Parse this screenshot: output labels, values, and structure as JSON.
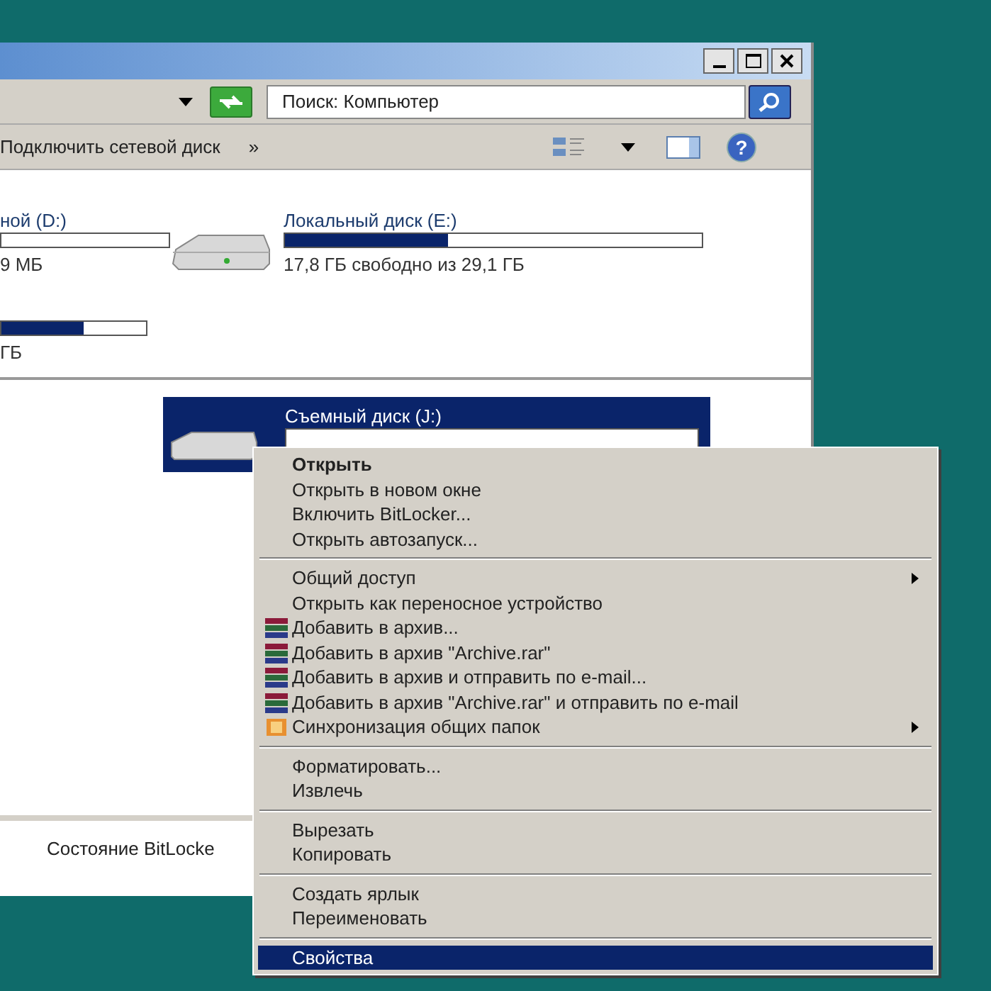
{
  "address_bar": {
    "search": {
      "placeholder": "Поиск: Компьютер"
    }
  },
  "toolbar": {
    "items": [
      {
        "label": "Подключить сетевой диск"
      },
      {
        "label": "»"
      }
    ],
    "help": {
      "label": "?"
    }
  },
  "drives": [
    {
      "name": "ной (D:)",
      "level": 0,
      "info": "9 МБ",
      "selected": false
    },
    {
      "name": "Локальный диск (E:)",
      "level": 0.39,
      "info": "17,8 ГБ свободно из 29,1 ГБ",
      "selected": false
    },
    {
      "level": 0.57,
      "info": "ГБ",
      "selected": false
    },
    {
      "name": "Съемный диск (J:)",
      "level": 0,
      "selected": true
    }
  ],
  "status_bar": {
    "text": "Состояние BitLocke"
  },
  "context_menu": {
    "items": [
      {
        "kind": "item",
        "label": "Открыть",
        "default": true,
        "selected": false
      },
      {
        "kind": "item",
        "label": "Открыть в новом окне",
        "selected": false
      },
      {
        "kind": "item",
        "label": "Включить BitLocker...",
        "selected": false
      },
      {
        "kind": "item",
        "label": "Открыть автозапуск...",
        "selected": false
      },
      {
        "kind": "separator"
      },
      {
        "kind": "item",
        "label": "Общий доступ",
        "submenu": true,
        "selected": false
      },
      {
        "kind": "item",
        "label": "Открыть как переносное устройство",
        "selected": false
      },
      {
        "kind": "archive",
        "label": "Добавить в архив...",
        "selected": false
      },
      {
        "kind": "archive",
        "label": "Добавить в архив \"Archive.rar\"",
        "selected": false
      },
      {
        "kind": "archive",
        "label": "Добавить в архив и отправить по e-mail...",
        "selected": false
      },
      {
        "kind": "archive",
        "label": "Добавить в архив \"Archive.rar\" и отправить по e-mail",
        "selected": false
      },
      {
        "kind": "sync",
        "label": "Синхронизация общих папок",
        "submenu": true,
        "selected": false
      },
      {
        "kind": "separator"
      },
      {
        "kind": "item",
        "label": "Форматировать...",
        "selected": false
      },
      {
        "kind": "item",
        "label": "Извлечь",
        "selected": false
      },
      {
        "kind": "separator"
      },
      {
        "kind": "item",
        "label": "Вырезать",
        "selected": false
      },
      {
        "kind": "item",
        "label": "Копировать",
        "selected": false
      },
      {
        "kind": "separator"
      },
      {
        "kind": "item",
        "label": "Создать ярлык",
        "selected": false
      },
      {
        "kind": "item",
        "label": "Переименовать",
        "selected": false
      },
      {
        "kind": "separator"
      },
      {
        "kind": "item",
        "label": "Свойства",
        "selected": true
      }
    ]
  }
}
